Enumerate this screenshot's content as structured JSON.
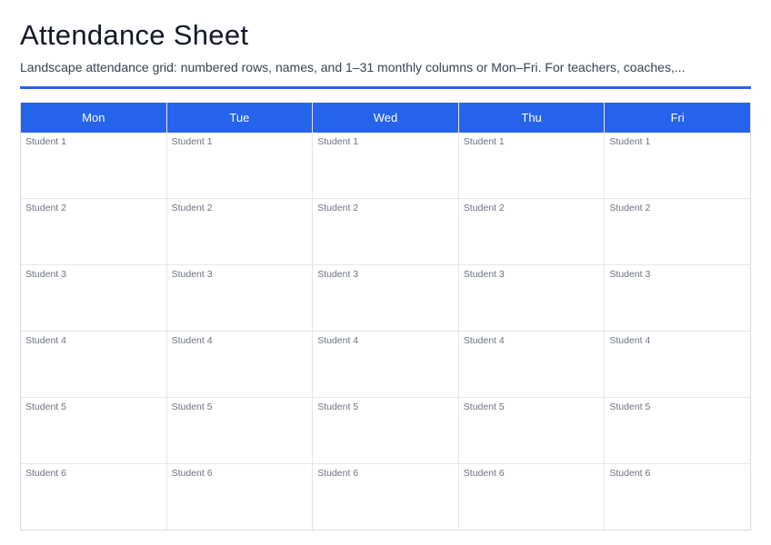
{
  "header": {
    "title": "Attendance Sheet",
    "subtitle": "Landscape attendance grid: numbered rows, names, and 1–31 monthly columns or Mon–Fri. For teachers, coaches,..."
  },
  "theme": {
    "accent": "#2563eb",
    "border": "#e5e7eb",
    "muted_text": "#6b7280"
  },
  "grid": {
    "days": [
      "Mon",
      "Tue",
      "Wed",
      "Thu",
      "Fri"
    ],
    "students": [
      "Student 1",
      "Student 2",
      "Student 3",
      "Student 4",
      "Student 5",
      "Student 6"
    ]
  }
}
